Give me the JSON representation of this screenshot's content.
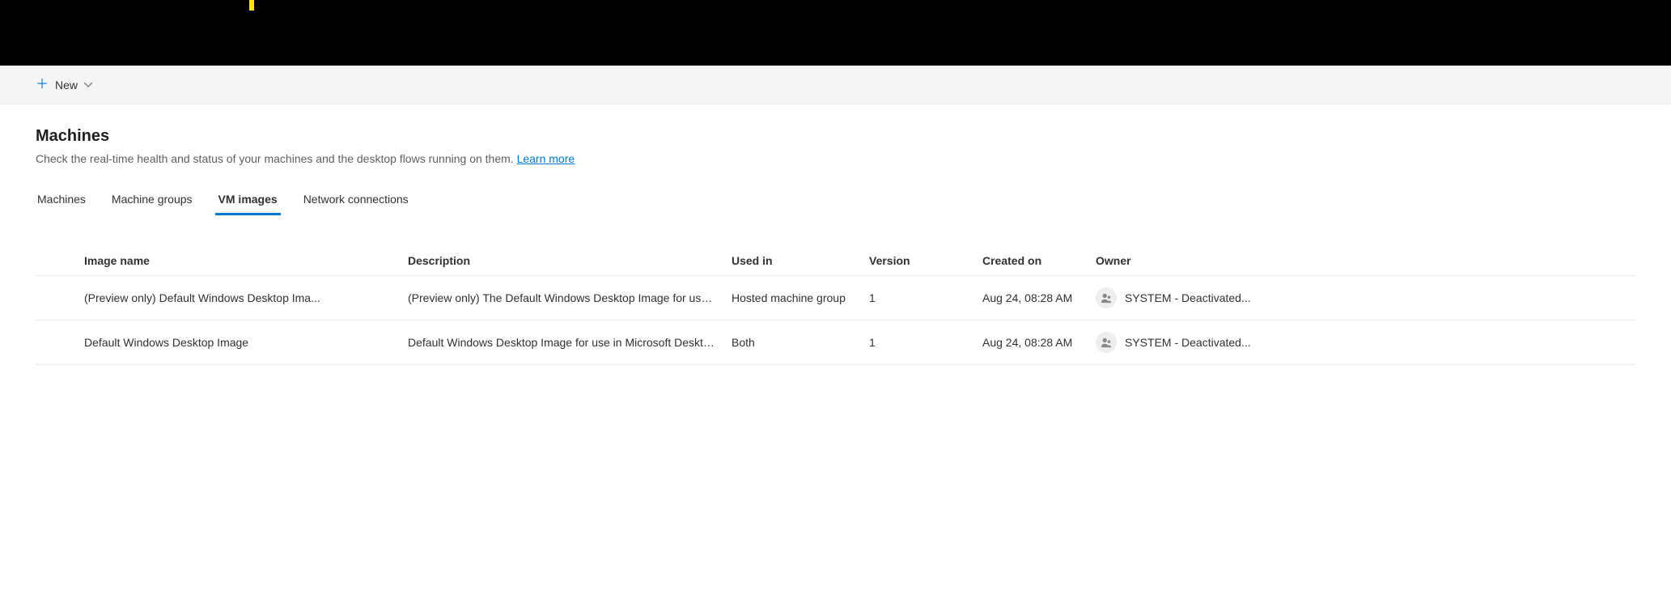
{
  "commandBar": {
    "newButtonLabel": "New"
  },
  "page": {
    "title": "Machines",
    "subtitle": "Check the real-time health and status of your machines and the desktop flows running on them. ",
    "learnMoreLabel": "Learn more"
  },
  "tabs": [
    {
      "label": "Machines",
      "active": false
    },
    {
      "label": "Machine groups",
      "active": false
    },
    {
      "label": "VM images",
      "active": true
    },
    {
      "label": "Network connections",
      "active": false
    }
  ],
  "table": {
    "headers": {
      "imageName": "Image name",
      "description": "Description",
      "usedIn": "Used in",
      "version": "Version",
      "createdOn": "Created on",
      "owner": "Owner"
    },
    "rows": [
      {
        "imageName": "(Preview only) Default Windows Desktop Ima...",
        "description": "(Preview only) The Default Windows Desktop Image for use i...",
        "usedIn": "Hosted machine group",
        "version": "1",
        "createdOn": "Aug 24, 08:28 AM",
        "owner": "SYSTEM - Deactivated..."
      },
      {
        "imageName": "Default Windows Desktop Image",
        "description": "Default Windows Desktop Image for use in Microsoft Deskto...",
        "usedIn": "Both",
        "version": "1",
        "createdOn": "Aug 24, 08:28 AM",
        "owner": "SYSTEM - Deactivated..."
      }
    ]
  }
}
